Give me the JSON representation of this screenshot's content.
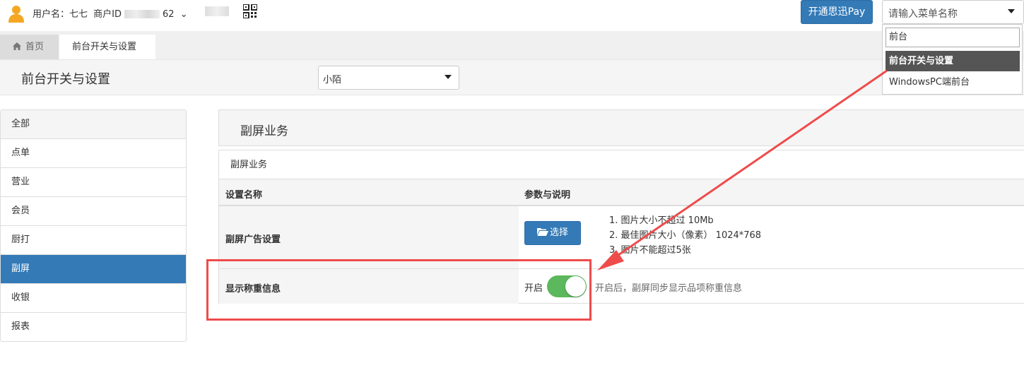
{
  "topbar": {
    "user_label": "用户名：七七",
    "merchant_label": "商户ID",
    "merchant_id_suffix": "62",
    "user_dropdown_caret": "⌄",
    "pay_button": "开通思迅Pay",
    "menu_search_placeholder": "请输入菜单名称"
  },
  "menu_dropdown": {
    "filter_value": "前台",
    "options": [
      "前台开关与设置",
      "WindowsPC端前台"
    ],
    "active_index": 0
  },
  "tabs": {
    "home": "首页",
    "active": "前台开关与设置"
  },
  "page_header": {
    "title": "前台开关与设置",
    "store_select_value": "小陌"
  },
  "sidebar": {
    "items": [
      "全部",
      "点单",
      "营业",
      "会员",
      "厨打",
      "副屏",
      "收银",
      "报表"
    ],
    "active_index": 5
  },
  "content": {
    "section_title": "副屏业务",
    "panel_title": "副屏业务",
    "columns": [
      "设置名称",
      "参数与说明"
    ],
    "rows": {
      "ad_setting": {
        "name": "副屏广告设置",
        "button": "选择",
        "rules": [
          "1. 图片大小不超过 10Mb",
          "2. 最佳图片大小（像素） 1024*768",
          "3. 图片不能超过5张"
        ]
      },
      "weight_info": {
        "name": "显示称重信息",
        "toggle_label": "开启",
        "toggle_on": true,
        "description": "开启后，副屏同步显示品项称重信息"
      }
    }
  },
  "colors": {
    "primary": "#337ab7",
    "toggle_on": "#5cb85c",
    "annotation": "#ef4b4b",
    "menu_active": "#555555"
  }
}
